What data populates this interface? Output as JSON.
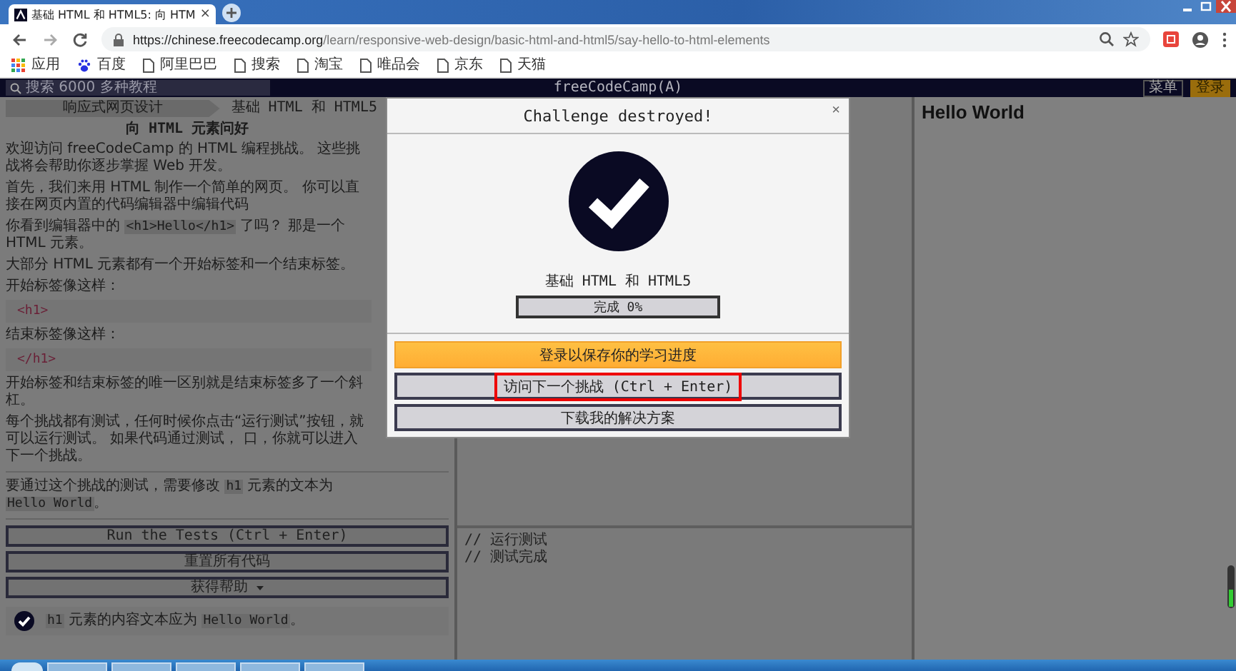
{
  "browser": {
    "tab": {
      "title": "基础 HTML 和 HTML5: 向 HTM",
      "close": "×"
    },
    "url": {
      "host": "https://chinese.freecodecamp.org",
      "path": "/learn/responsive-web-design/basic-html-and-html5/say-hello-to-html-elements"
    },
    "bookmarks": [
      {
        "label": "应用",
        "kind": "apps"
      },
      {
        "label": "百度",
        "kind": "paw"
      },
      {
        "label": "阿里巴巴",
        "kind": "page"
      },
      {
        "label": "搜索",
        "kind": "page"
      },
      {
        "label": "淘宝",
        "kind": "page"
      },
      {
        "label": "唯品会",
        "kind": "page"
      },
      {
        "label": "京东",
        "kind": "page"
      },
      {
        "label": "天猫",
        "kind": "page"
      }
    ]
  },
  "navbar": {
    "search": {
      "placeholder": "搜索 6000 多种教程"
    },
    "logo": "freeCodeCamp(A)",
    "buttons": [
      {
        "label": "菜单",
        "kind": "outline"
      },
      {
        "label": "登录",
        "kind": "filled"
      }
    ]
  },
  "lesson": {
    "breadcrumb": [
      "响应式网页设计",
      "基础 HTML 和 HTML5"
    ],
    "title": "向 HTML 元素问好",
    "blocks": [
      {
        "kind": "p",
        "segments": [
          {
            "kind": "text",
            "text": "欢迎访问 freeCodeCamp 的 HTML 编程挑战。 这些挑战将会帮助你逐步掌握 Web 开发。"
          }
        ]
      },
      {
        "kind": "p",
        "segments": [
          {
            "kind": "text",
            "text": "首先，我们来用 HTML 制作一个简单的网页。 你可以直接在网页内置的代码编辑器中编辑代码"
          }
        ]
      },
      {
        "kind": "p",
        "segments": [
          {
            "kind": "text",
            "text": "你看到编辑器中的 "
          },
          {
            "kind": "code",
            "text": "<h1>Hello</h1>"
          },
          {
            "kind": "text",
            "text": " 了吗？ 那是一个 HTML 元素。"
          }
        ]
      },
      {
        "kind": "p",
        "segments": [
          {
            "kind": "text",
            "text": "大部分 HTML 元素都有一个开始标签和一个结束标签。"
          }
        ]
      },
      {
        "kind": "p",
        "segments": [
          {
            "kind": "text",
            "text": "开始标签像这样："
          }
        ]
      },
      {
        "kind": "code",
        "text": "<h1>"
      },
      {
        "kind": "p",
        "segments": [
          {
            "kind": "text",
            "text": "结束标签像这样："
          }
        ]
      },
      {
        "kind": "code",
        "text": "</h1>"
      },
      {
        "kind": "p",
        "segments": [
          {
            "kind": "text",
            "text": "开始标签和结束标签的唯一区别就是结束标签多了一个斜杠。"
          }
        ]
      },
      {
        "kind": "p",
        "segments": [
          {
            "kind": "text",
            "text": "每个挑战都有测试，任何时候你点击“运行测试”按钮，就可以运行测试。 如果代码通过测试， 口，你就可以进入下一个挑战。"
          }
        ]
      },
      {
        "kind": "rule"
      },
      {
        "kind": "p",
        "segments": [
          {
            "kind": "text",
            "text": "要通过这个挑战的测试，需要修改 "
          },
          {
            "kind": "code",
            "text": "h1"
          },
          {
            "kind": "text",
            "text": " 元素的文本为 "
          },
          {
            "kind": "code",
            "text": "Hello World"
          },
          {
            "kind": "text",
            "text": "。"
          }
        ]
      },
      {
        "kind": "rule"
      }
    ],
    "buttons": [
      {
        "label": "Run the Tests (Ctrl + Enter)",
        "kind": "plain"
      },
      {
        "label": "重置所有代码",
        "kind": "plain"
      },
      {
        "label": "获得帮助",
        "kind": "dropdown"
      }
    ],
    "tests": [
      {
        "passed": true,
        "segments": [
          {
            "kind": "code",
            "text": "h1"
          },
          {
            "kind": "text",
            "text": " 元素的内容文本应为 "
          },
          {
            "kind": "code",
            "text": "Hello World"
          },
          {
            "kind": "text",
            "text": "。"
          }
        ]
      }
    ]
  },
  "editor": {
    "console": [
      "// 运行测试",
      "// 测试完成"
    ]
  },
  "preview": {
    "heading": "Hello World"
  },
  "modal": {
    "title": "Challenge destroyed!",
    "close": "×",
    "block": "基础 HTML 和 HTML5",
    "progress": {
      "label": "完成 0%",
      "level": 0
    },
    "buttons": [
      {
        "label": "登录以保存你的学习进度",
        "kind": "primary",
        "highlighted": false
      },
      {
        "label": "访问下一个挑战 (Ctrl + Enter)",
        "kind": "secondary",
        "highlighted": true
      },
      {
        "label": "下载我的解决方案",
        "kind": "secondary",
        "highlighted": false
      }
    ]
  }
}
